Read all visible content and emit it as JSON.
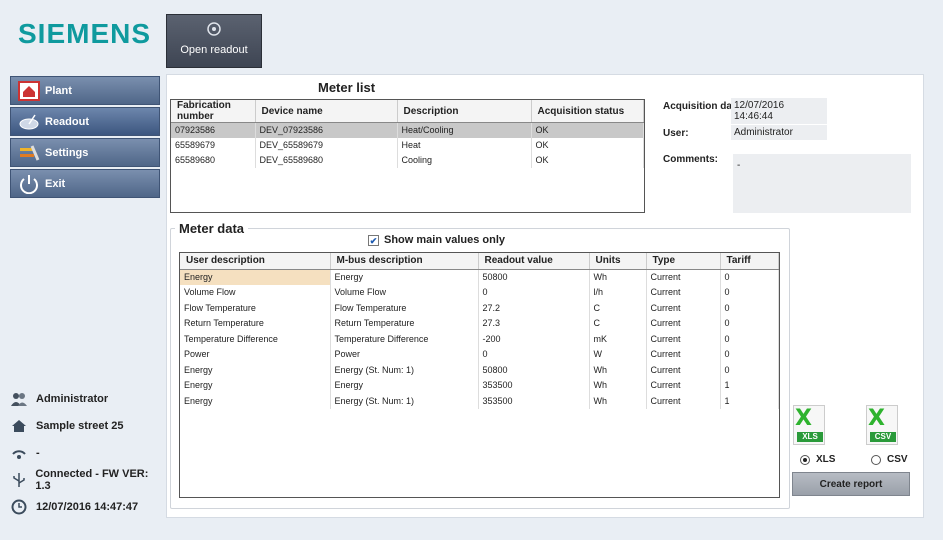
{
  "brand": "SIEMENS",
  "toolbar": {
    "open_readout": "Open readout"
  },
  "nav": [
    {
      "label": "Plant",
      "icon": "house-icon"
    },
    {
      "label": "Readout",
      "icon": "satellite-dish-icon"
    },
    {
      "label": "Settings",
      "icon": "wrench-icon"
    },
    {
      "label": "Exit",
      "icon": "power-icon"
    }
  ],
  "status": {
    "user": "Administrator",
    "address": "Sample street 25",
    "signal": "-",
    "connection": "Connected - FW VER: 1.3",
    "datetime": "12/07/2016 14:47:47"
  },
  "meter_list": {
    "title": "Meter list",
    "columns": [
      "Fabrication number",
      "Device name",
      "Description",
      "Acquisition status"
    ],
    "rows": [
      [
        "07923586",
        "DEV_07923586",
        "Heat/Cooling",
        "OK"
      ],
      [
        "65589679",
        "DEV_65589679",
        "Heat",
        "OK"
      ],
      [
        "65589680",
        "DEV_65589680",
        "Cooling",
        "OK"
      ]
    ],
    "selected_row": 0
  },
  "acquisition": {
    "date_label": "Acquisition date",
    "date_value": "12/07/2016 14:46:44",
    "user_label": "User:",
    "user_value": "Administrator",
    "comments_label": "Comments:",
    "comments_value": "-"
  },
  "meter_data": {
    "title": "Meter data",
    "show_main_label": "Show main values only",
    "show_main_checked": true,
    "columns": [
      "User description",
      "M-bus description",
      "Readout value",
      "Units",
      "Type",
      "Tariff"
    ],
    "rows": [
      [
        "Energy",
        "Energy",
        "50800",
        "Wh",
        "Current",
        "0"
      ],
      [
        "Volume Flow",
        "Volume Flow",
        "0",
        "l/h",
        "Current",
        "0"
      ],
      [
        "Flow Temperature",
        "Flow Temperature",
        "27.2",
        "C",
        "Current",
        "0"
      ],
      [
        "Return Temperature",
        "Return Temperature",
        "27.3",
        "C",
        "Current",
        "0"
      ],
      [
        "Temperature Difference",
        "Temperature Difference",
        "-200",
        "mK",
        "Current",
        "0"
      ],
      [
        "Power",
        "Power",
        "0",
        "W",
        "Current",
        "0"
      ],
      [
        "Energy",
        "Energy (St. Num: 1)",
        "50800",
        "Wh",
        "Current",
        "0"
      ],
      [
        "Energy",
        "Energy",
        "353500",
        "Wh",
        "Current",
        "1"
      ],
      [
        "Energy",
        "Energy (St. Num: 1)",
        "353500",
        "Wh",
        "Current",
        "1"
      ]
    ]
  },
  "export": {
    "xls_tag": "XLS",
    "csv_tag": "CSV",
    "xls_label": "XLS",
    "csv_label": "CSV",
    "selected": "XLS",
    "create_report": "Create report"
  },
  "colors": {
    "brand": "#0f9a9e",
    "nav": "#4f6688",
    "toolbar": "#3e4553"
  }
}
